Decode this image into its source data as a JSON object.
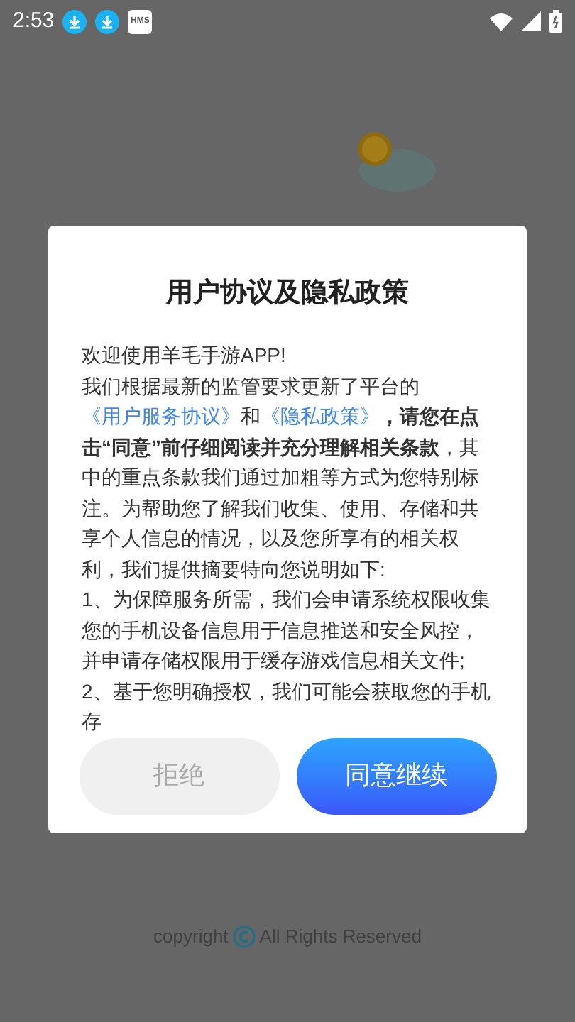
{
  "status_bar": {
    "time": "2:53",
    "notification_badge": "HMS"
  },
  "dialog": {
    "title": "用户协议及隐私政策",
    "paragraphs": [
      [
        {
          "kind": "text",
          "text": "欢迎使用羊毛手游APP!"
        }
      ],
      [
        {
          "kind": "text",
          "text": "我们根据最新的监管要求更新了平台的"
        },
        {
          "kind": "link",
          "text": "《用户服务协议》"
        },
        {
          "kind": "text",
          "text": "和"
        },
        {
          "kind": "link",
          "text": "《隐私政策》"
        },
        {
          "kind": "text",
          "text": "**，请您在点击“同意”前仔细阅读并充分理解相关条款**，其中的重点条款我们通过加粗等方式为您特别标注。为帮助您了解我们收集、使用、存储和共享个人信息的情况，以及您所享有的相关权利，我们提供摘要特向您说明如下:"
        }
      ],
      [
        {
          "kind": "text",
          "text": "1、为保障服务所需，我们会申请系统权限收集您的手机设备信息用于信息推送和安全风控，并申请存储权限用于缓存游戏信息相关文件;"
        }
      ],
      [
        {
          "kind": "text",
          "text": "2、基于您明确授权，我们可能会获取您的手机存"
        }
      ]
    ],
    "buttons": [
      {
        "label": "拒绝",
        "kind": "secondary"
      },
      {
        "label": "同意继续",
        "kind": "primary"
      }
    ]
  },
  "footer": {
    "before": "copyright",
    "after": "All Rights Reserved"
  }
}
